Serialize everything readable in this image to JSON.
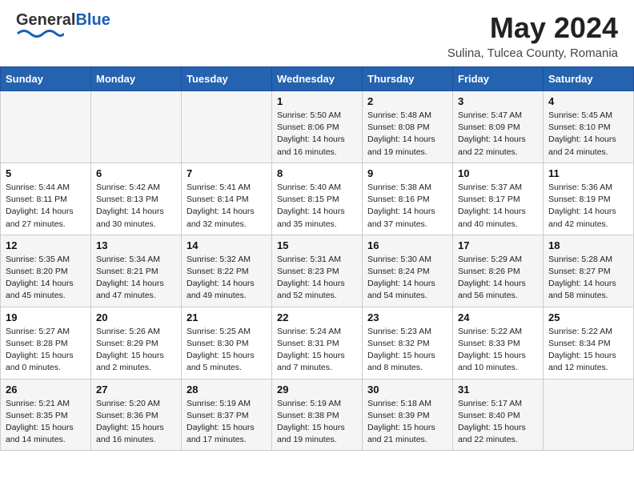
{
  "header": {
    "logo_general": "General",
    "logo_blue": "Blue",
    "month_title": "May 2024",
    "subtitle": "Sulina, Tulcea County, Romania"
  },
  "days_of_week": [
    "Sunday",
    "Monday",
    "Tuesday",
    "Wednesday",
    "Thursday",
    "Friday",
    "Saturday"
  ],
  "weeks": [
    [
      {
        "day": "",
        "sunrise": "",
        "sunset": "",
        "daylight": ""
      },
      {
        "day": "",
        "sunrise": "",
        "sunset": "",
        "daylight": ""
      },
      {
        "day": "",
        "sunrise": "",
        "sunset": "",
        "daylight": ""
      },
      {
        "day": "1",
        "sunrise": "Sunrise: 5:50 AM",
        "sunset": "Sunset: 8:06 PM",
        "daylight": "Daylight: 14 hours and 16 minutes."
      },
      {
        "day": "2",
        "sunrise": "Sunrise: 5:48 AM",
        "sunset": "Sunset: 8:08 PM",
        "daylight": "Daylight: 14 hours and 19 minutes."
      },
      {
        "day": "3",
        "sunrise": "Sunrise: 5:47 AM",
        "sunset": "Sunset: 8:09 PM",
        "daylight": "Daylight: 14 hours and 22 minutes."
      },
      {
        "day": "4",
        "sunrise": "Sunrise: 5:45 AM",
        "sunset": "Sunset: 8:10 PM",
        "daylight": "Daylight: 14 hours and 24 minutes."
      }
    ],
    [
      {
        "day": "5",
        "sunrise": "Sunrise: 5:44 AM",
        "sunset": "Sunset: 8:11 PM",
        "daylight": "Daylight: 14 hours and 27 minutes."
      },
      {
        "day": "6",
        "sunrise": "Sunrise: 5:42 AM",
        "sunset": "Sunset: 8:13 PM",
        "daylight": "Daylight: 14 hours and 30 minutes."
      },
      {
        "day": "7",
        "sunrise": "Sunrise: 5:41 AM",
        "sunset": "Sunset: 8:14 PM",
        "daylight": "Daylight: 14 hours and 32 minutes."
      },
      {
        "day": "8",
        "sunrise": "Sunrise: 5:40 AM",
        "sunset": "Sunset: 8:15 PM",
        "daylight": "Daylight: 14 hours and 35 minutes."
      },
      {
        "day": "9",
        "sunrise": "Sunrise: 5:38 AM",
        "sunset": "Sunset: 8:16 PM",
        "daylight": "Daylight: 14 hours and 37 minutes."
      },
      {
        "day": "10",
        "sunrise": "Sunrise: 5:37 AM",
        "sunset": "Sunset: 8:17 PM",
        "daylight": "Daylight: 14 hours and 40 minutes."
      },
      {
        "day": "11",
        "sunrise": "Sunrise: 5:36 AM",
        "sunset": "Sunset: 8:19 PM",
        "daylight": "Daylight: 14 hours and 42 minutes."
      }
    ],
    [
      {
        "day": "12",
        "sunrise": "Sunrise: 5:35 AM",
        "sunset": "Sunset: 8:20 PM",
        "daylight": "Daylight: 14 hours and 45 minutes."
      },
      {
        "day": "13",
        "sunrise": "Sunrise: 5:34 AM",
        "sunset": "Sunset: 8:21 PM",
        "daylight": "Daylight: 14 hours and 47 minutes."
      },
      {
        "day": "14",
        "sunrise": "Sunrise: 5:32 AM",
        "sunset": "Sunset: 8:22 PM",
        "daylight": "Daylight: 14 hours and 49 minutes."
      },
      {
        "day": "15",
        "sunrise": "Sunrise: 5:31 AM",
        "sunset": "Sunset: 8:23 PM",
        "daylight": "Daylight: 14 hours and 52 minutes."
      },
      {
        "day": "16",
        "sunrise": "Sunrise: 5:30 AM",
        "sunset": "Sunset: 8:24 PM",
        "daylight": "Daylight: 14 hours and 54 minutes."
      },
      {
        "day": "17",
        "sunrise": "Sunrise: 5:29 AM",
        "sunset": "Sunset: 8:26 PM",
        "daylight": "Daylight: 14 hours and 56 minutes."
      },
      {
        "day": "18",
        "sunrise": "Sunrise: 5:28 AM",
        "sunset": "Sunset: 8:27 PM",
        "daylight": "Daylight: 14 hours and 58 minutes."
      }
    ],
    [
      {
        "day": "19",
        "sunrise": "Sunrise: 5:27 AM",
        "sunset": "Sunset: 8:28 PM",
        "daylight": "Daylight: 15 hours and 0 minutes."
      },
      {
        "day": "20",
        "sunrise": "Sunrise: 5:26 AM",
        "sunset": "Sunset: 8:29 PM",
        "daylight": "Daylight: 15 hours and 2 minutes."
      },
      {
        "day": "21",
        "sunrise": "Sunrise: 5:25 AM",
        "sunset": "Sunset: 8:30 PM",
        "daylight": "Daylight: 15 hours and 5 minutes."
      },
      {
        "day": "22",
        "sunrise": "Sunrise: 5:24 AM",
        "sunset": "Sunset: 8:31 PM",
        "daylight": "Daylight: 15 hours and 7 minutes."
      },
      {
        "day": "23",
        "sunrise": "Sunrise: 5:23 AM",
        "sunset": "Sunset: 8:32 PM",
        "daylight": "Daylight: 15 hours and 8 minutes."
      },
      {
        "day": "24",
        "sunrise": "Sunrise: 5:22 AM",
        "sunset": "Sunset: 8:33 PM",
        "daylight": "Daylight: 15 hours and 10 minutes."
      },
      {
        "day": "25",
        "sunrise": "Sunrise: 5:22 AM",
        "sunset": "Sunset: 8:34 PM",
        "daylight": "Daylight: 15 hours and 12 minutes."
      }
    ],
    [
      {
        "day": "26",
        "sunrise": "Sunrise: 5:21 AM",
        "sunset": "Sunset: 8:35 PM",
        "daylight": "Daylight: 15 hours and 14 minutes."
      },
      {
        "day": "27",
        "sunrise": "Sunrise: 5:20 AM",
        "sunset": "Sunset: 8:36 PM",
        "daylight": "Daylight: 15 hours and 16 minutes."
      },
      {
        "day": "28",
        "sunrise": "Sunrise: 5:19 AM",
        "sunset": "Sunset: 8:37 PM",
        "daylight": "Daylight: 15 hours and 17 minutes."
      },
      {
        "day": "29",
        "sunrise": "Sunrise: 5:19 AM",
        "sunset": "Sunset: 8:38 PM",
        "daylight": "Daylight: 15 hours and 19 minutes."
      },
      {
        "day": "30",
        "sunrise": "Sunrise: 5:18 AM",
        "sunset": "Sunset: 8:39 PM",
        "daylight": "Daylight: 15 hours and 21 minutes."
      },
      {
        "day": "31",
        "sunrise": "Sunrise: 5:17 AM",
        "sunset": "Sunset: 8:40 PM",
        "daylight": "Daylight: 15 hours and 22 minutes."
      },
      {
        "day": "",
        "sunrise": "",
        "sunset": "",
        "daylight": ""
      }
    ]
  ]
}
